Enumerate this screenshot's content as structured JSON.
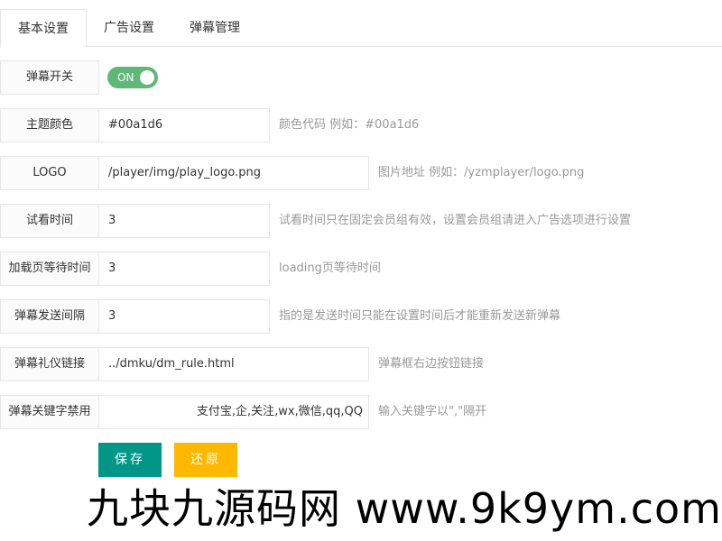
{
  "tabs": [
    {
      "label": "基本设置",
      "active": true
    },
    {
      "label": "广告设置",
      "active": false
    },
    {
      "label": "弹幕管理",
      "active": false
    }
  ],
  "form": {
    "danmaku_switch": {
      "label": "弹幕开关",
      "state_text": "ON",
      "on": true
    },
    "theme_color": {
      "label": "主题颜色",
      "value": "#00a1d6",
      "hint": "颜色代码 例如：#00a1d6"
    },
    "logo": {
      "label": "LOGO",
      "value": "/player/img/play_logo.png",
      "hint": "图片地址 例如：/yzmplayer/logo.png"
    },
    "trial_time": {
      "label": "试看时间",
      "value": "3",
      "hint": "试看时间只在固定会员组有效，设置会员组请进入广告选项进行设置"
    },
    "loading_wait": {
      "label": "加载页等待时间",
      "value": "3",
      "hint": "loading页等待时间"
    },
    "send_interval": {
      "label": "弹幕发送间隔",
      "value": "3",
      "hint": "指的是发送时间只能在设置时间后才能重新发送新弹幕"
    },
    "etiquette_link": {
      "label": "弹幕礼仪链接",
      "value": "../dmku/dm_rule.html",
      "hint": "弹幕框右边按钮链接"
    },
    "banned_keywords": {
      "label": "弹幕关键字禁用",
      "value": "支付宝,企,关注,wx,微信,qq,QQ",
      "hint": "输入关键字以\",\"隔开"
    }
  },
  "buttons": {
    "save": "保存",
    "reset": "还原"
  },
  "watermark": "九块九源码网 www.9k9ym.com",
  "colors": {
    "switch_on": "#5fb878",
    "save_button": "#009688",
    "reset_button": "#ffb800",
    "hint_text": "#999999",
    "border": "#e6e6e6"
  }
}
